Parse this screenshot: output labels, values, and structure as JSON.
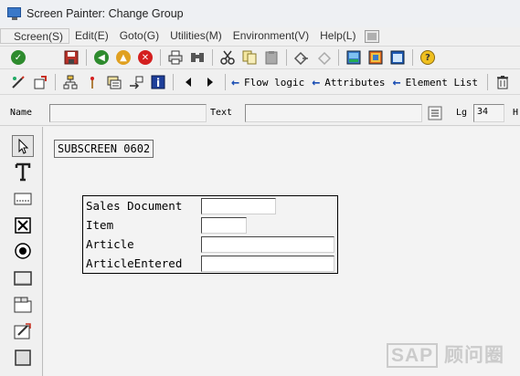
{
  "window": {
    "title": "Screen Painter: Change Group"
  },
  "menu": [
    {
      "label": "Screen(S)"
    },
    {
      "label": "Edit(E)"
    },
    {
      "label": "Goto(G)"
    },
    {
      "label": "Utilities(M)"
    },
    {
      "label": "Environment(V)"
    },
    {
      "label": "Help(L)"
    }
  ],
  "toolbar2": {
    "flow_logic": "Flow logic",
    "attributes": "Attributes",
    "element_list": "Element List"
  },
  "fields": {
    "name_label": "Name",
    "name_value": "",
    "text_label": "Text",
    "text_value": "",
    "lg_label": "Lg",
    "lg_value": "34",
    "h_label": "H"
  },
  "canvas": {
    "subscreen_label": "SUBSCREEN 0602",
    "rows": [
      {
        "label": "Sales Document"
      },
      {
        "label": "Item"
      },
      {
        "label": "Article"
      },
      {
        "label": "ArticleEntered"
      }
    ]
  },
  "watermark": {
    "sap": "SAP",
    "text": "顾问圈"
  },
  "colors": {
    "accent": "#1c4fb4",
    "confirm_green": "#2e8b2e",
    "cancel_red": "#d42020"
  }
}
